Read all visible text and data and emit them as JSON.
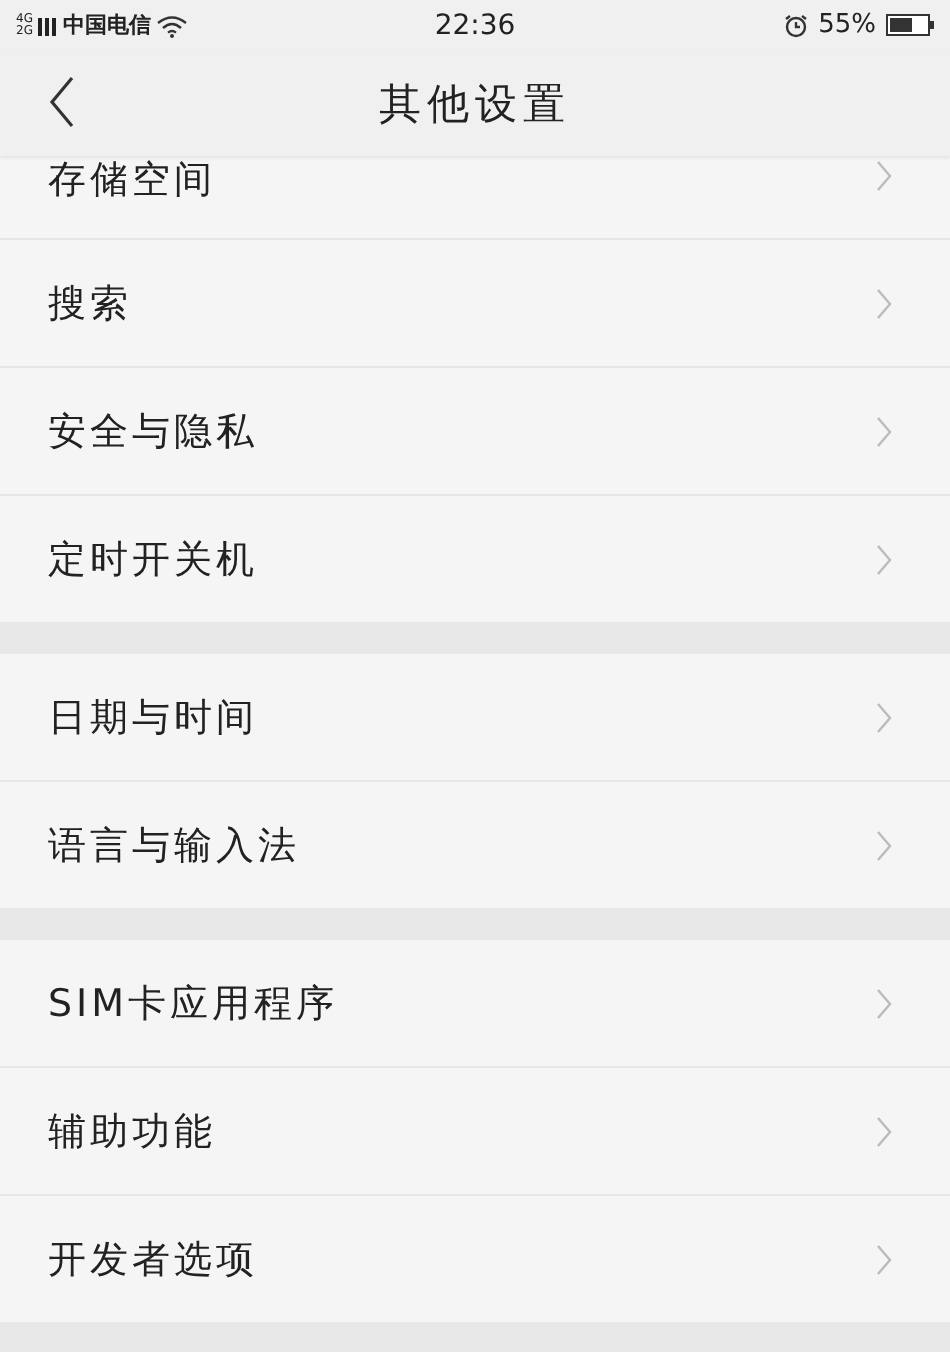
{
  "status_bar": {
    "networks": [
      "4G",
      "2G"
    ],
    "carrier": "中国电信",
    "time": "22:36",
    "battery": "55%"
  },
  "header": {
    "title": "其他设置"
  },
  "groups": [
    {
      "items": [
        {
          "label": "存储空间",
          "partial": true
        },
        {
          "label": "搜索",
          "partial": false
        },
        {
          "label": "安全与隐私",
          "partial": false
        },
        {
          "label": "定时开关机",
          "partial": false
        }
      ]
    },
    {
      "items": [
        {
          "label": "日期与时间",
          "partial": false
        },
        {
          "label": "语言与输入法",
          "partial": false
        }
      ]
    },
    {
      "items": [
        {
          "label": "SIM卡应用程序",
          "partial": false
        },
        {
          "label": "辅助功能",
          "partial": false
        },
        {
          "label": "开发者选项",
          "partial": false
        }
      ]
    }
  ]
}
